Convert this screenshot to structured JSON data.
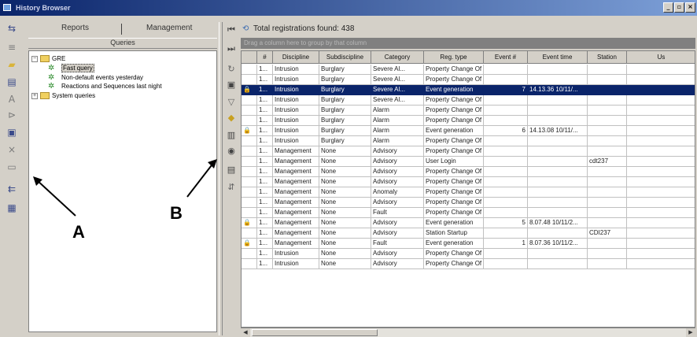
{
  "window": {
    "title": "History Browser",
    "min": "_",
    "max": "▫",
    "close": "×"
  },
  "left_panel": {
    "tabs": [
      "Reports",
      "Management"
    ],
    "queries_header": "Queries",
    "tree": [
      {
        "label": "GRE",
        "kind": "folder",
        "expander": "−",
        "level": 0
      },
      {
        "label": "Fast query",
        "kind": "query",
        "level": 1,
        "selected": true
      },
      {
        "label": "Non-default events yesterday",
        "kind": "query",
        "level": 1
      },
      {
        "label": "Reactions and Sequences last night",
        "kind": "query",
        "level": 1
      },
      {
        "label": "System queries",
        "kind": "folder",
        "expander": "+",
        "level": 0
      }
    ]
  },
  "annotations": {
    "a": "A",
    "b": "B"
  },
  "results": {
    "total_label": "Total registrations found: 438",
    "group_hint": "Drag a column here to group by that column",
    "columns": [
      "#",
      "Discipline",
      "Subdiscipline",
      "Category",
      "Reg. type",
      "Event #",
      "Event time",
      "Station",
      "Us"
    ],
    "rows": [
      {
        "lock": false,
        "n": "1...",
        "discipline": "Intrusion",
        "sub": "Burglary",
        "cat": "Severe Al...",
        "reg": "Property Change Of State",
        "evn": "",
        "time": "",
        "station": "",
        "selected": false
      },
      {
        "lock": false,
        "n": "1...",
        "discipline": "Intrusion",
        "sub": "Burglary",
        "cat": "Severe Al...",
        "reg": "Property Change Of State",
        "evn": "",
        "time": "",
        "station": "",
        "selected": false
      },
      {
        "lock": true,
        "n": "1...",
        "discipline": "Intrusion",
        "sub": "Burglary",
        "cat": "Severe Al...",
        "reg": "Event generation",
        "evn": "7",
        "time": "14.13.36 10/11/...",
        "station": "",
        "selected": true
      },
      {
        "lock": false,
        "n": "1...",
        "discipline": "Intrusion",
        "sub": "Burglary",
        "cat": "Severe Al...",
        "reg": "Property Change Of State",
        "evn": "",
        "time": "",
        "station": "",
        "selected": false
      },
      {
        "lock": false,
        "n": "1...",
        "discipline": "Intrusion",
        "sub": "Burglary",
        "cat": "Alarm",
        "reg": "Property Change Of State",
        "evn": "",
        "time": "",
        "station": "",
        "selected": false
      },
      {
        "lock": false,
        "n": "1...",
        "discipline": "Intrusion",
        "sub": "Burglary",
        "cat": "Alarm",
        "reg": "Property Change Of State",
        "evn": "",
        "time": "",
        "station": "",
        "selected": false
      },
      {
        "lock": true,
        "n": "1...",
        "discipline": "Intrusion",
        "sub": "Burglary",
        "cat": "Alarm",
        "reg": "Event generation",
        "evn": "6",
        "time": "14.13.08 10/11/...",
        "station": "",
        "selected": false
      },
      {
        "lock": false,
        "n": "1...",
        "discipline": "Intrusion",
        "sub": "Burglary",
        "cat": "Alarm",
        "reg": "Property Change Of State",
        "evn": "",
        "time": "",
        "station": "",
        "selected": false
      },
      {
        "lock": false,
        "n": "1...",
        "discipline": "Management",
        "sub": "None",
        "cat": "Advisory",
        "reg": "Property Change Of State",
        "evn": "",
        "time": "",
        "station": "",
        "selected": false
      },
      {
        "lock": false,
        "n": "1...",
        "discipline": "Management",
        "sub": "None",
        "cat": "Advisory",
        "reg": "User Login",
        "evn": "",
        "time": "",
        "station": "cdt237",
        "selected": false
      },
      {
        "lock": false,
        "n": "1...",
        "discipline": "Management",
        "sub": "None",
        "cat": "Advisory",
        "reg": "Property Change Of State",
        "evn": "",
        "time": "",
        "station": "",
        "selected": false
      },
      {
        "lock": false,
        "n": "1...",
        "discipline": "Management",
        "sub": "None",
        "cat": "Advisory",
        "reg": "Property Change Of State",
        "evn": "",
        "time": "",
        "station": "",
        "selected": false
      },
      {
        "lock": false,
        "n": "1...",
        "discipline": "Management",
        "sub": "None",
        "cat": "Anomaly",
        "reg": "Property Change Of State",
        "evn": "",
        "time": "",
        "station": "",
        "selected": false
      },
      {
        "lock": false,
        "n": "1...",
        "discipline": "Management",
        "sub": "None",
        "cat": "Advisory",
        "reg": "Property Change Of State",
        "evn": "",
        "time": "",
        "station": "",
        "selected": false
      },
      {
        "lock": false,
        "n": "1...",
        "discipline": "Management",
        "sub": "None",
        "cat": "Fault",
        "reg": "Property Change Of State",
        "evn": "",
        "time": "",
        "station": "",
        "selected": false
      },
      {
        "lock": true,
        "n": "1...",
        "discipline": "Management",
        "sub": "None",
        "cat": "Advisory",
        "reg": "Event generation",
        "evn": "5",
        "time": "8.07.48 10/11/2...",
        "station": "",
        "selected": false
      },
      {
        "lock": false,
        "n": "1...",
        "discipline": "Management",
        "sub": "None",
        "cat": "Advisory",
        "reg": "Station Startup",
        "evn": "",
        "time": "",
        "station": "CDI237",
        "selected": false
      },
      {
        "lock": true,
        "n": "1...",
        "discipline": "Management",
        "sub": "None",
        "cat": "Fault",
        "reg": "Event generation",
        "evn": "1",
        "time": "8.07.36 10/11/2...",
        "station": "",
        "selected": false
      },
      {
        "lock": false,
        "n": "1...",
        "discipline": "Intrusion",
        "sub": "None",
        "cat": "Advisory",
        "reg": "Property Change Of State",
        "evn": "",
        "time": "",
        "station": "",
        "selected": false
      },
      {
        "lock": false,
        "n": "1...",
        "discipline": "Intrusion",
        "sub": "None",
        "cat": "Advisory",
        "reg": "Property Change Of State",
        "evn": "",
        "time": "",
        "station": "",
        "selected": false
      }
    ]
  },
  "icons": {
    "lock": "🔒",
    "left_toolbar": [
      "arrows-icon",
      "list-icon",
      "folder-icon",
      "report-icon",
      "text-icon",
      "filter-icon",
      "print-icon",
      "delete-icon",
      "blank-icon",
      "export-icon",
      "grid-icon"
    ],
    "mid_toolbar": [
      "first-icon",
      "last-icon",
      "refresh-icon",
      "save-icon",
      "filter-icon",
      "lock-icon",
      "columns-icon",
      "eye-icon",
      "print-icon",
      "sort-icon"
    ]
  }
}
